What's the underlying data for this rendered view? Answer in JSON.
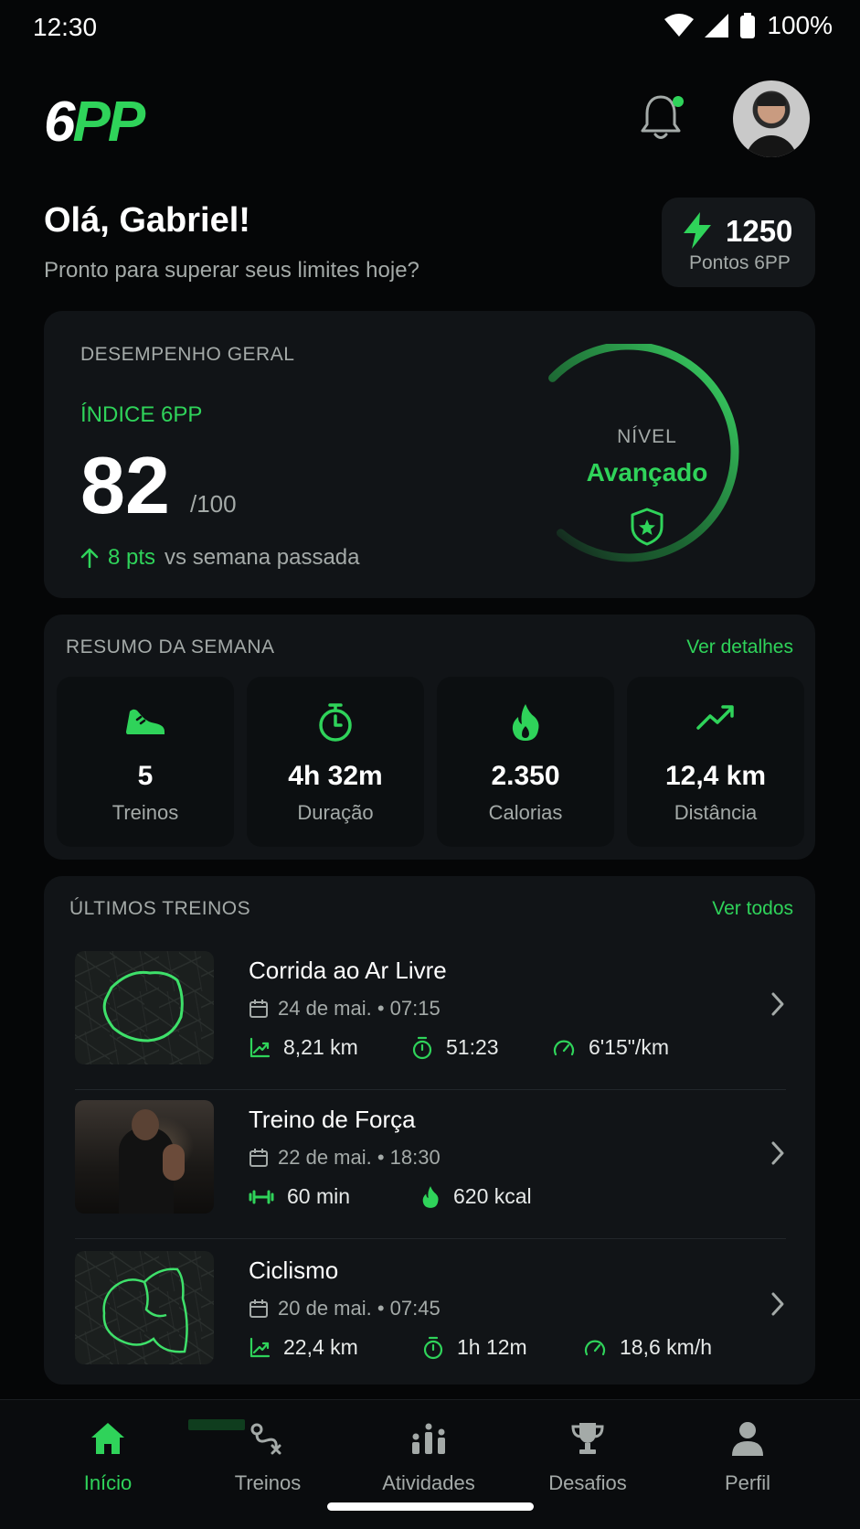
{
  "status_bar": {
    "time": "12:30",
    "battery": "100%"
  },
  "header": {
    "logo_six": "6",
    "logo_pp": "PP",
    "notification_dot": true
  },
  "greeting": {
    "title": "Olá, Gabriel!",
    "subtitle": "Pronto para superar seus limites hoje?"
  },
  "points": {
    "value": "1250",
    "label": "Pontos 6PP"
  },
  "performance": {
    "caption": "DESEMPENHO GERAL",
    "index_label": "ÍNDICE 6PP",
    "score": "82",
    "max": "/100",
    "trend_value": "8 pts",
    "trend_text": "vs semana passada",
    "gauge_fraction": 0.82,
    "level_label": "NÍVEL",
    "level_value": "Avançado"
  },
  "week": {
    "caption": "RESUMO DA SEMANA",
    "link": "Ver detalhes",
    "tiles": [
      {
        "icon": "sneaker-icon",
        "value": "5",
        "label": "Treinos"
      },
      {
        "icon": "stopwatch-icon",
        "value": "4h 32m",
        "label": "Duração"
      },
      {
        "icon": "flame-icon",
        "value": "2.350",
        "label": "Calorias"
      },
      {
        "icon": "trend-up-icon",
        "value": "12,4 km",
        "label": "Distância"
      }
    ]
  },
  "recent": {
    "caption": "ÚLTIMOS TREINOS",
    "link": "Ver todos",
    "items": [
      {
        "title": "Corrida ao Ar Livre",
        "date": "24 de mai. • 07:15",
        "stats": [
          "8,21 km",
          "51:23",
          "6'15\"/km"
        ]
      },
      {
        "title": "Treino de Força",
        "date": "22 de mai. • 18:30",
        "stats": [
          "60 min",
          "620 kcal"
        ]
      },
      {
        "title": "Ciclismo",
        "date": "20 de mai. • 07:45",
        "stats": [
          "22,4 km",
          "1h 12m",
          "18,6 km/h"
        ]
      }
    ]
  },
  "nav": {
    "items": [
      {
        "label": "Início",
        "icon": "home-icon",
        "active": true
      },
      {
        "label": "Treinos",
        "icon": "route-icon",
        "active": false
      },
      {
        "label": "Atividades",
        "icon": "activity-bars-icon",
        "active": false
      },
      {
        "label": "Desafios",
        "icon": "trophy-icon",
        "active": false
      },
      {
        "label": "Perfil",
        "icon": "person-icon",
        "active": false
      }
    ]
  },
  "colors": {
    "accent": "#2fd35a",
    "background": "#050607",
    "card": "#111417",
    "muted": "#a4aaa8"
  }
}
